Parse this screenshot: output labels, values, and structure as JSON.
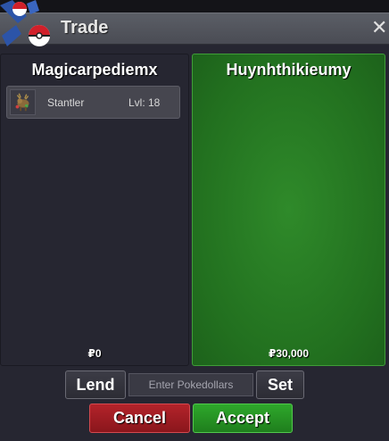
{
  "window": {
    "title": "Trade",
    "close_glyph": "✕"
  },
  "left_panel": {
    "player_name": "Magicarpediemx",
    "money": "₽0",
    "pokemon": [
      {
        "name": "Stantler",
        "level": "Lvl: 18",
        "icon": "stantler-sprite-icon"
      }
    ]
  },
  "right_panel": {
    "player_name": "Huynhthikieumy",
    "money": "₽30,000"
  },
  "controls": {
    "lend_label": "Lend",
    "pokedollar_placeholder": "Enter Pokedollars",
    "set_label": "Set",
    "cancel_label": "Cancel",
    "accept_label": "Accept"
  },
  "colors": {
    "accept_green": "#2ea82b",
    "cancel_red": "#b3232a",
    "panel_bg": "#262631",
    "partner_panel_green": "#2f8a2a"
  }
}
